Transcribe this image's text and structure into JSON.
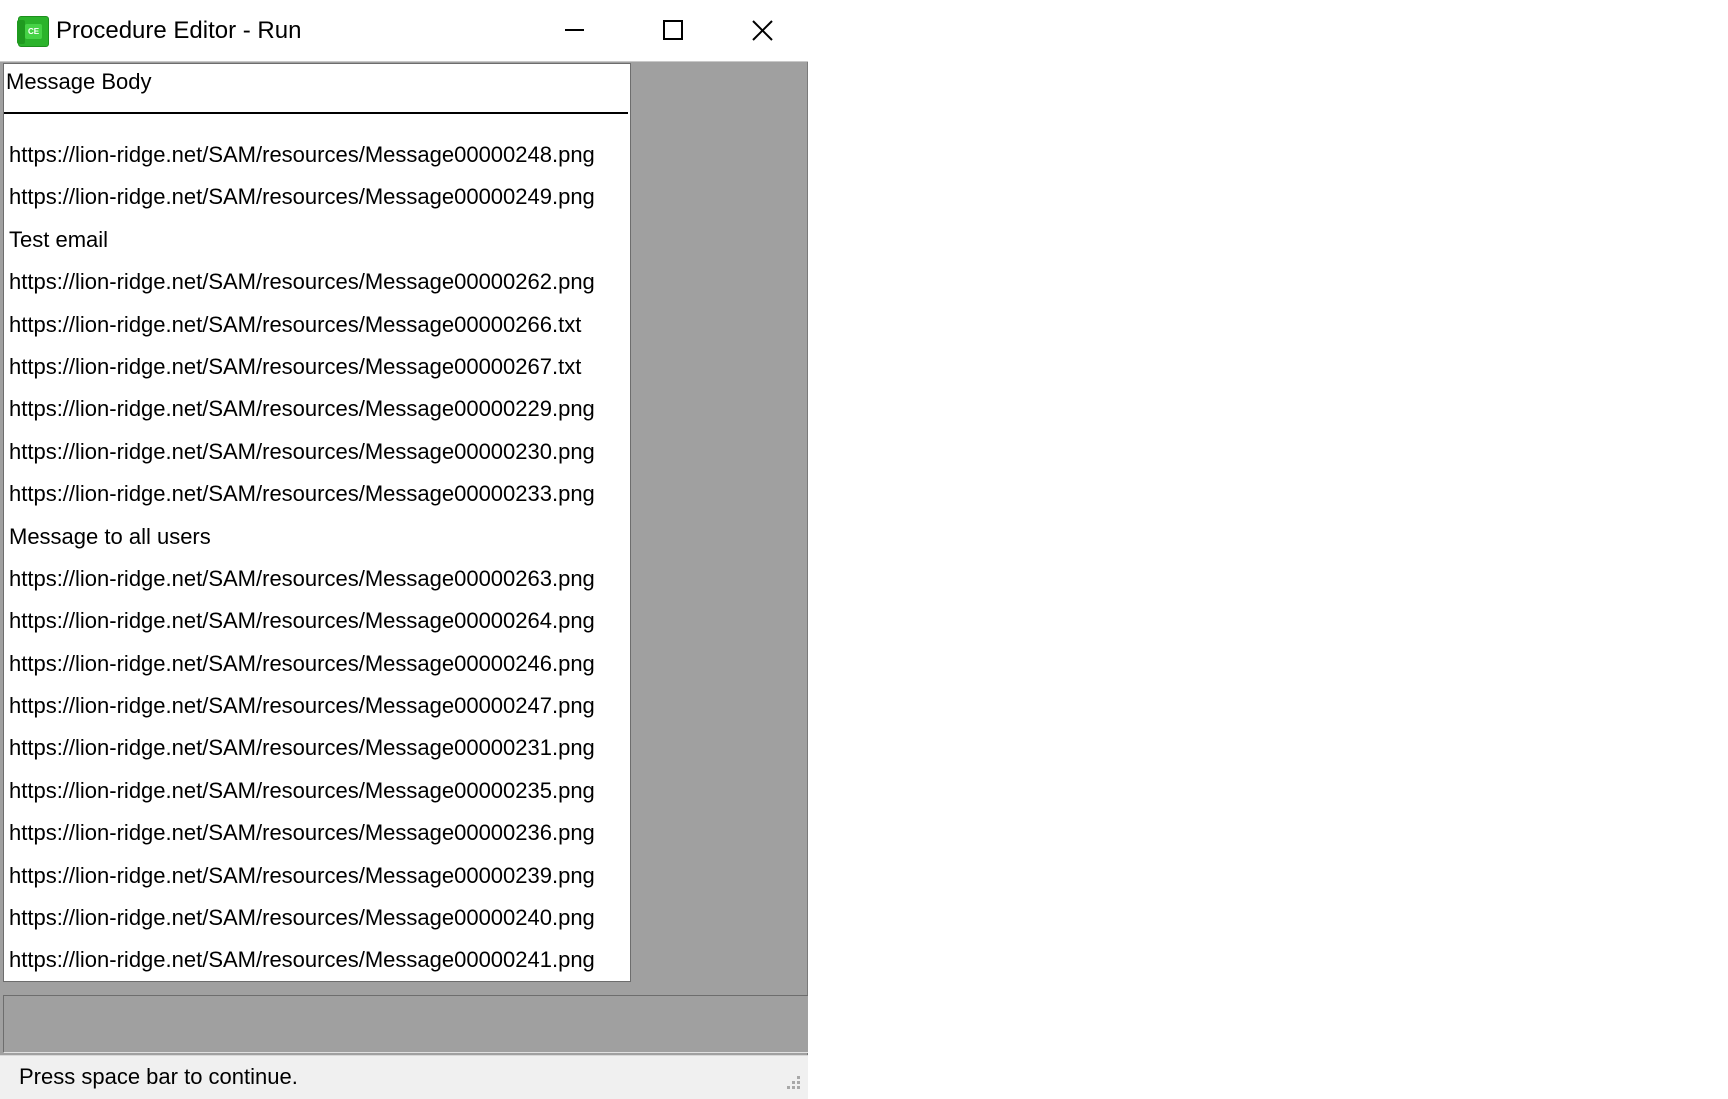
{
  "window": {
    "title": "Procedure Editor - Run",
    "app_icon_glyph": "CE"
  },
  "caption_buttons": {
    "minimize": "minimize-icon",
    "maximize": "maximize-icon",
    "close": "close-icon"
  },
  "list": {
    "header": "Message Body",
    "items": [
      "https://lion-ridge.net/SAM/resources/Message00000248.png",
      "https://lion-ridge.net/SAM/resources/Message00000249.png",
      "Test email",
      "https://lion-ridge.net/SAM/resources/Message00000262.png",
      "https://lion-ridge.net/SAM/resources/Message00000266.txt",
      "https://lion-ridge.net/SAM/resources/Message00000267.txt",
      "https://lion-ridge.net/SAM/resources/Message00000229.png",
      "https://lion-ridge.net/SAM/resources/Message00000230.png",
      "https://lion-ridge.net/SAM/resources/Message00000233.png",
      "Message to all users",
      "https://lion-ridge.net/SAM/resources/Message00000263.png",
      "https://lion-ridge.net/SAM/resources/Message00000264.png",
      "https://lion-ridge.net/SAM/resources/Message00000246.png",
      "https://lion-ridge.net/SAM/resources/Message00000247.png",
      "https://lion-ridge.net/SAM/resources/Message00000231.png",
      "https://lion-ridge.net/SAM/resources/Message00000235.png",
      "https://lion-ridge.net/SAM/resources/Message00000236.png",
      "https://lion-ridge.net/SAM/resources/Message00000239.png",
      "https://lion-ridge.net/SAM/resources/Message00000240.png",
      "https://lion-ridge.net/SAM/resources/Message00000241.png"
    ]
  },
  "status": {
    "text": "Press space bar to continue."
  },
  "colors": {
    "client_background": "#a0a0a0",
    "app_icon_green": "#2bb32b"
  }
}
